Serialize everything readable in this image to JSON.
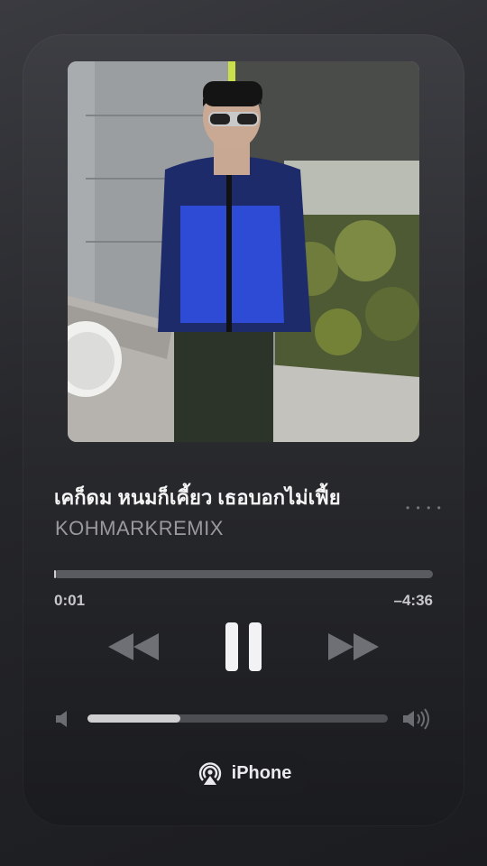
{
  "track": {
    "title": "เคก็ดม หนมก็เคี้ยว เธอบอกไม่เฟี้ย",
    "artist": "KOHMARKREMIX",
    "more_icon": "ellipsis-icon"
  },
  "playback": {
    "elapsed": "0:01",
    "remaining": "–4:36",
    "progress_fraction": 0.004
  },
  "controls": {
    "rewind_icon": "rewind-icon",
    "pause_icon": "pause-icon",
    "forward_icon": "fast-forward-icon"
  },
  "volume": {
    "level_fraction": 0.31,
    "low_icon": "speaker-low-icon",
    "high_icon": "speaker-high-icon"
  },
  "output": {
    "device_label": "iPhone",
    "icon": "airplay-icon"
  },
  "colors": {
    "accent_text": "#f4f4f4",
    "secondary_text": "#9a9a9e"
  }
}
